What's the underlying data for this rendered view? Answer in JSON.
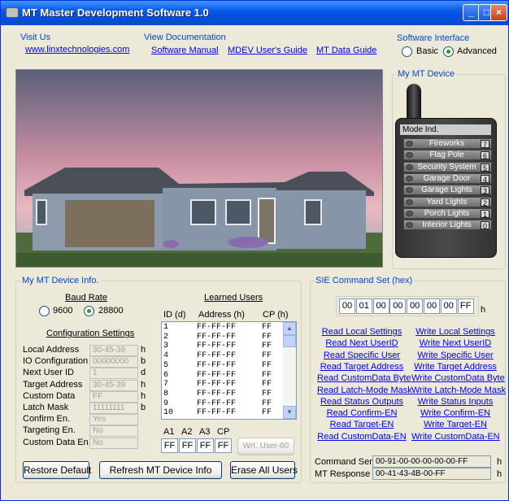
{
  "window": {
    "title": "MT Master Development Software 1.0"
  },
  "links": {
    "visit_us_label": "Visit Us",
    "visit_url": "www.linxtechnologies.com",
    "view_docs_label": "View Documentation",
    "software_manual": "Software Manual",
    "mdev_guide": "MDEV User's Guide",
    "mt_data_guide": "MT Data Guide"
  },
  "interface": {
    "label": "Software Interface",
    "basic": "Basic",
    "advanced": "Advanced",
    "selected": "Advanced"
  },
  "device": {
    "label": "My MT Device",
    "mode_ind": "Mode Ind.",
    "buttons": [
      {
        "name": "Fireworks",
        "num": "7"
      },
      {
        "name": "Flag Pole",
        "num": "6"
      },
      {
        "name": "Security System",
        "num": "5"
      },
      {
        "name": "Garage Door",
        "num": "4"
      },
      {
        "name": "Garage Lights",
        "num": "3"
      },
      {
        "name": "Yard Lights",
        "num": "2"
      },
      {
        "name": "Porch Lights",
        "num": "1"
      },
      {
        "name": "Interior Lights",
        "num": "0"
      }
    ]
  },
  "info": {
    "label": "My MT Device Info.",
    "baud_rate": "Baud Rate",
    "baud_9600": "9600",
    "baud_28800": "28800",
    "baud_selected": "28800",
    "config_title": "Configuration Settings",
    "config": [
      {
        "label": "Local Address",
        "value": "30-45-39",
        "unit": "h"
      },
      {
        "label": "IO Configuration",
        "value": "00000000",
        "unit": "b"
      },
      {
        "label": "Next User ID",
        "value": "1",
        "unit": "d"
      },
      {
        "label": "Target Address",
        "value": "30-45-39",
        "unit": "h"
      },
      {
        "label": "Custom Data",
        "value": "FF",
        "unit": "h"
      },
      {
        "label": "Latch Mask",
        "value": "11111111",
        "unit": "b"
      },
      {
        "label": "Confirm En.",
        "value": "Yes",
        "unit": ""
      },
      {
        "label": "Targeting En.",
        "value": "No",
        "unit": ""
      },
      {
        "label": "Custom Data En.",
        "value": "No",
        "unit": ""
      }
    ],
    "learned_title": "Learned Users",
    "col_id": "ID (d)",
    "col_addr": "Address (h)",
    "col_cp": "CP (h)",
    "learned": [
      {
        "id": "1",
        "addr": "FF-FF-FF",
        "cp": "FF"
      },
      {
        "id": "2",
        "addr": "FF-FF-FF",
        "cp": "FF"
      },
      {
        "id": "3",
        "addr": "FF-FF-FF",
        "cp": "FF"
      },
      {
        "id": "4",
        "addr": "FF-FF-FF",
        "cp": "FF"
      },
      {
        "id": "5",
        "addr": "FF-FF-FF",
        "cp": "FF"
      },
      {
        "id": "6",
        "addr": "FF-FF-FF",
        "cp": "FF"
      },
      {
        "id": "7",
        "addr": "FF-FF-FF",
        "cp": "FF"
      },
      {
        "id": "8",
        "addr": "FF-FF-FF",
        "cp": "FF"
      },
      {
        "id": "9",
        "addr": "FF-FF-FF",
        "cp": "FF"
      },
      {
        "id": "10",
        "addr": "FF-FF-FF",
        "cp": "FF"
      }
    ],
    "a1": "A1",
    "a2": "A2",
    "a3": "A3",
    "cp": "CP",
    "a1v": "FF",
    "a2v": "FF",
    "a3v": "FF",
    "cpv": "FF",
    "write_user": "Wrt. User-60",
    "restore": "Restore Default",
    "refresh": "Refresh MT Device Info",
    "erase": "Erase All Users"
  },
  "sie": {
    "label": "SIE Command Set (hex)",
    "bytes": [
      "00",
      "01",
      "00",
      "00",
      "00",
      "00",
      "00",
      "FF"
    ],
    "unit": "h",
    "cmds_left": [
      "Read Local Settings",
      "Read Next UserID",
      "Read Specific User",
      "Read Target Address",
      "Read CustomData Byte",
      "Read Latch-Mode Mask",
      "Read Status Outputs",
      "Read Confirm-EN",
      "Read Target-EN",
      "Read CustomData-EN"
    ],
    "cmds_right": [
      "Write Local Settings",
      "Write Next UserID",
      "Write Specific User",
      "Write Target Address",
      "Write CustomData Byte",
      "Write Latch-Mode Mask",
      "Write Status Inputs",
      "Write Confirm-EN",
      "Write Target-EN",
      "Write CustomData-EN"
    ],
    "sent_label": "Command Sent",
    "sent_value": "00-91-00-00-00-00-00-FF",
    "resp_label": "MT Response",
    "resp_value": "00-41-43-4B-00-FF",
    "unit_h": "h"
  },
  "colors": {
    "title_blue": "#0a5ce8",
    "link": "#0000ee",
    "group": "#0046d5"
  }
}
